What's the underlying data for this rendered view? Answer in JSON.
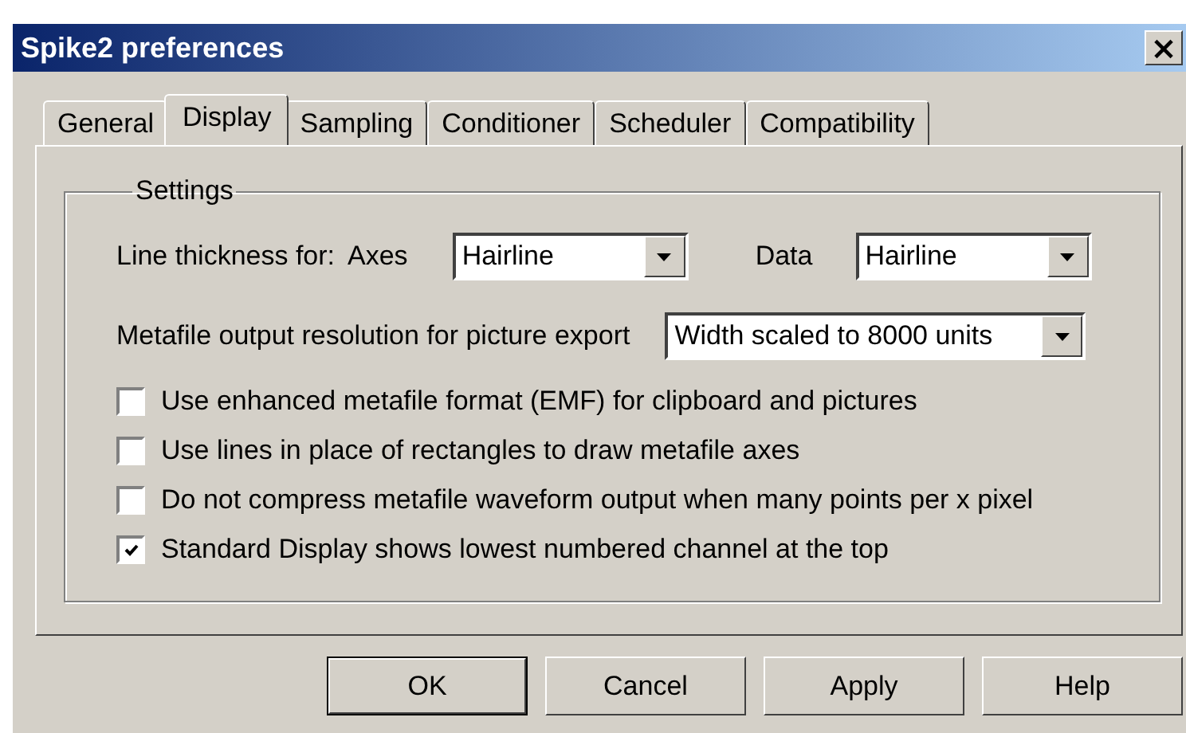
{
  "window": {
    "title": "Spike2 preferences",
    "close": "×"
  },
  "tabs": [
    {
      "label": "General",
      "selected": false
    },
    {
      "label": "Display",
      "selected": true
    },
    {
      "label": "Sampling",
      "selected": false
    },
    {
      "label": "Conditioner",
      "selected": false
    },
    {
      "label": "Scheduler",
      "selected": false
    },
    {
      "label": "Compatibility",
      "selected": false
    }
  ],
  "settings": {
    "title": "Settings",
    "line_thickness": {
      "label": "Line thickness for:",
      "axes_label": "Axes",
      "axes_value": "Hairline",
      "data_label": "Data",
      "data_value": "Hairline"
    },
    "metafile_resolution": {
      "label": "Metafile output resolution for picture export",
      "value": "Width scaled to 8000 units"
    },
    "options": [
      {
        "label": "Use enhanced metafile format (EMF) for clipboard and pictures",
        "checked": false
      },
      {
        "label": "Use lines in place of rectangles to draw metafile axes",
        "checked": false
      },
      {
        "label": "Do not compress metafile waveform output when many points per x pixel",
        "checked": false
      },
      {
        "label": "Standard Display shows lowest numbered channel at the top",
        "checked": true
      }
    ]
  },
  "buttons": [
    {
      "label": "OK",
      "default": true
    },
    {
      "label": "Cancel",
      "default": false
    },
    {
      "label": "Apply",
      "default": false
    },
    {
      "label": "Help",
      "default": false
    }
  ]
}
